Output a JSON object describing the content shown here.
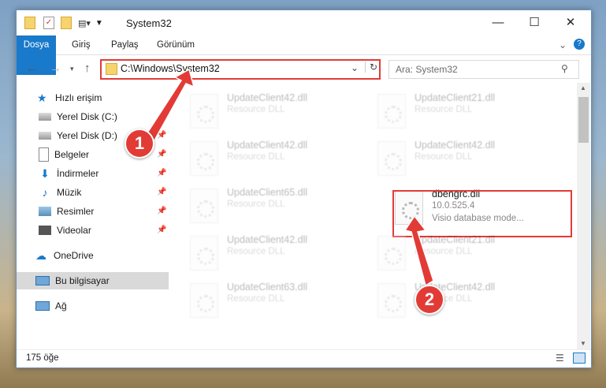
{
  "window": {
    "title": "System32",
    "buttons": {
      "minimize": "—",
      "maximize": "☐",
      "close": "✕"
    }
  },
  "ribbon": {
    "tabs": [
      "Dosya",
      "Giriş",
      "Paylaş",
      "Görünüm"
    ],
    "help_glyph": "?"
  },
  "address": {
    "path": "C:\\Windows\\System32",
    "search_placeholder": "Ara: System32"
  },
  "nav": {
    "items": [
      {
        "label": "Hızlı erişim",
        "icon": "star-icon",
        "pinned": false
      },
      {
        "label": "Yerel Disk (C:)",
        "icon": "drive-icon",
        "pinned": true
      },
      {
        "label": "Yerel Disk (D:)",
        "icon": "drive-icon",
        "pinned": true
      },
      {
        "label": "Belgeler",
        "icon": "documents-icon",
        "pinned": true
      },
      {
        "label": "İndirmeler",
        "icon": "download-icon",
        "pinned": true
      },
      {
        "label": "Müzik",
        "icon": "music-icon",
        "pinned": true
      },
      {
        "label": "Resimler",
        "icon": "pictures-icon",
        "pinned": true
      },
      {
        "label": "Videolar",
        "icon": "videos-icon",
        "pinned": true
      },
      {
        "label": "OneDrive",
        "icon": "cloud-icon",
        "pinned": false
      },
      {
        "label": "Bu bilgisayar",
        "icon": "computer-icon",
        "pinned": false,
        "selected": true
      },
      {
        "label": "Ağ",
        "icon": "network-icon",
        "pinned": false
      }
    ]
  },
  "files": [
    {
      "name": "UpdateClient42.dll",
      "type": "Resource DLL"
    },
    {
      "name": "UpdateClient21.dll",
      "type": "Resource DLL"
    },
    {
      "name": "UpdateClient42.dll",
      "type": "Resource DLL"
    },
    {
      "name": "UpdateClient42.dll",
      "type": "Resource DLL"
    },
    {
      "name": "UpdateClient65.dll",
      "type": "Resource DLL"
    },
    {
      "name": "dbengrc.dll",
      "version": "10.0.525.4",
      "type": "Visio database mode..."
    },
    {
      "name": "UpdateClient42.dll",
      "type": "Resource DLL"
    },
    {
      "name": "UpdateClient21.dll",
      "type": "Resource DLL"
    },
    {
      "name": "UpdateClient63.dll",
      "type": "Resource DLL"
    },
    {
      "name": "UpdateClient42.dll",
      "type": "Resource DLL"
    }
  ],
  "status": {
    "count": "175 öğe"
  },
  "callouts": [
    "1",
    "2"
  ],
  "colors": {
    "accent": "#1979ca",
    "highlight": "#e23b36"
  }
}
